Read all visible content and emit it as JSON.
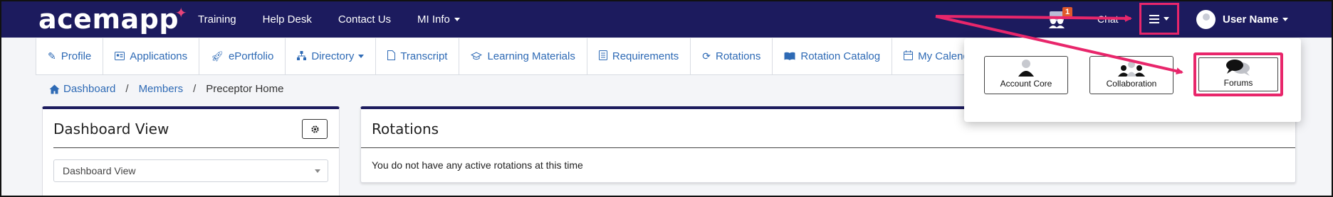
{
  "header": {
    "logo": "acemapp",
    "nav": [
      {
        "label": "Training"
      },
      {
        "label": "Help Desk"
      },
      {
        "label": "Contact Us"
      },
      {
        "label": "MI Info"
      }
    ],
    "notification_count": "1",
    "chat_label": "Chat",
    "user_name": "User Name"
  },
  "subnav": [
    {
      "label": "Profile",
      "icon": "pencil-icon"
    },
    {
      "label": "Applications",
      "icon": "id-card-icon"
    },
    {
      "label": "ePortfolio",
      "icon": "rocket-icon"
    },
    {
      "label": "Directory",
      "icon": "sitemap-icon"
    },
    {
      "label": "Transcript",
      "icon": "file-icon"
    },
    {
      "label": "Learning Materials",
      "icon": "graduation-cap-icon"
    },
    {
      "label": "Requirements",
      "icon": "list-icon"
    },
    {
      "label": "Rotations",
      "icon": "refresh-icon"
    },
    {
      "label": "Rotation Catalog",
      "icon": "book-open-icon"
    },
    {
      "label": "My Calendar",
      "icon": "calendar-icon"
    }
  ],
  "breadcrumb": {
    "items": [
      "Dashboard",
      "Members",
      "Preceptor Home"
    ],
    "separator": "/"
  },
  "dashboard_card": {
    "title": "Dashboard View",
    "select_value": "Dashboard View"
  },
  "rotations_card": {
    "title": "Rotations",
    "message": "You do not have any active rotations at this time"
  },
  "menu_dropdown": {
    "tiles": [
      {
        "label": "Account Core",
        "icon": "user-icon"
      },
      {
        "label": "Collaboration",
        "icon": "users-icon"
      },
      {
        "label": "Forums",
        "icon": "comments-icon"
      }
    ]
  },
  "colors": {
    "navbar": "#1c1b5e",
    "link": "#2e6ab5",
    "highlight": "#e8266b",
    "badge": "#e0592b"
  }
}
